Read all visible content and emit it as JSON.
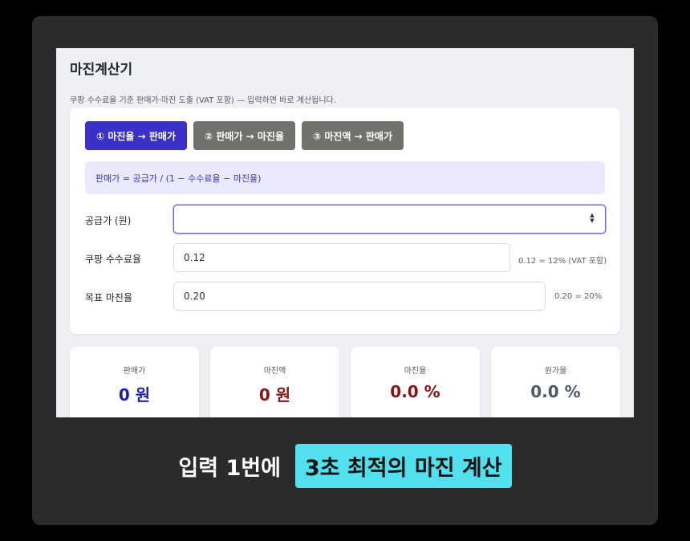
{
  "app": {
    "title": "마진계산기",
    "subtitle": "쿠팡 수수료율 기준 판매가·마진 도출 (VAT 포함) — 입력하면 바로 계산됩니다."
  },
  "tabs": [
    {
      "label": "① 마진율 → 판매가",
      "active": true
    },
    {
      "label": "② 판매가 → 마진율",
      "active": false
    },
    {
      "label": "③ 마진액 → 판매가",
      "active": false
    }
  ],
  "formula": "판매가 = 공급가 / (1 − 수수료율 − 마진율)",
  "fields": {
    "supply_price": {
      "label": "공급가 (원)",
      "value": ""
    },
    "commission": {
      "label": "쿠팡 수수료율",
      "value": "0.12",
      "hint": "0.12 = 12% (VAT 포함)"
    },
    "target_margin": {
      "label": "목표 마진율",
      "value": "0.20",
      "hint": "0.20 = 20%"
    }
  },
  "results": [
    {
      "label": "판매가",
      "value": "0 원"
    },
    {
      "label": "마진액",
      "value": "0 원"
    },
    {
      "label": "마진율",
      "value": "0.0 %"
    },
    {
      "label": "원가율",
      "value": "0.0 %"
    }
  ],
  "caption": {
    "plain": "입력 1번에",
    "highlight": "3초 최적의 마진 계산"
  },
  "colors": {
    "accent": "#3a31c8",
    "inactive_tab": "#70736c",
    "price_value": "#1b1fb0",
    "margin_amount_value": "#8a1414",
    "margin_rate_value": "#8a1414",
    "cost_rate_value": "#4f5866",
    "caption_highlight": "#53e0ee"
  },
  "icons": {
    "stepper": "stepper-arrows-icon"
  }
}
